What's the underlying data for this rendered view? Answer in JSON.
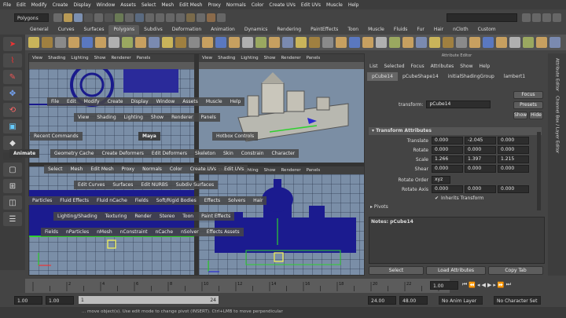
{
  "menubar": [
    "File",
    "Edit",
    "Modify",
    "Create",
    "Display",
    "Window",
    "Assets",
    "Select",
    "Mesh",
    "Edit Mesh",
    "Proxy",
    "Normals",
    "Color",
    "Create UVs",
    "Edit UVs",
    "Muscle",
    "Help"
  ],
  "status": {
    "mode": "Polygons"
  },
  "shelf_tabs": [
    "General",
    "Curves",
    "Surfaces",
    "Polygons",
    "Subdivs",
    "Deformation",
    "Animation",
    "Dynamics",
    "Rendering",
    "PaintEffects",
    "Toon",
    "Muscle",
    "Fluids",
    "Fur",
    "Hair",
    "nCloth",
    "Custom"
  ],
  "shelf_active": "Polygons",
  "viewport_menu": [
    "View",
    "Shading",
    "Lighting",
    "Show",
    "Renderer",
    "Panels"
  ],
  "hotbox": {
    "row1": [
      "File",
      "Edit",
      "Modify",
      "Create",
      "Display",
      "Window",
      "Assets",
      "Muscle",
      "Help"
    ],
    "row2": [
      "View",
      "Shading",
      "Lighting",
      "Show",
      "Renderer",
      "Panels"
    ],
    "recent": "Recent Commands",
    "maya": "Maya",
    "hotbox_controls": "Hotbox Controls",
    "row3": [
      "Geometry Cache",
      "Create Deformers",
      "Edit Deformers",
      "Skeleton",
      "Skin",
      "Constrain",
      "Character"
    ],
    "animate": "Animate",
    "row4": [
      "Select",
      "Mesh",
      "Edit Mesh",
      "Proxy",
      "Normals",
      "Color",
      "Create UVs",
      "Edit UVs"
    ],
    "row5": [
      "Edit Curves",
      "Surfaces",
      "Edit NURBS",
      "Subdiv Surfaces"
    ],
    "row6": [
      "Particles",
      "Fluid Effects",
      "Fluid nCache",
      "Fields",
      "Soft/Rigid Bodies",
      "Effects",
      "Solvers",
      "Hair"
    ],
    "row7": [
      "Lighting/Shading",
      "Texturing",
      "Render",
      "Stereo",
      "Toon",
      "Paint Effects"
    ],
    "row8": [
      "Fields",
      "nParticles",
      "nMesh",
      "nConstraint",
      "nCache",
      "nSolver",
      "Effects Assets"
    ]
  },
  "attr": {
    "title": "Attribute Editor",
    "menu": [
      "List",
      "Selected",
      "Focus",
      "Attributes",
      "Show",
      "Help"
    ],
    "tabs": [
      "pCube14",
      "pCubeShape14",
      "initialShadingGroup",
      "lambert1"
    ],
    "transform_label": "transform:",
    "transform_value": "pCube14",
    "focus": "Focus",
    "presets": "Presets",
    "show": "Show",
    "hide": "Hide",
    "section": "Transform Attributes",
    "translate": {
      "label": "Translate",
      "values": [
        "0.000",
        "-2.045",
        "0.000"
      ]
    },
    "rotate": {
      "label": "Rotate",
      "values": [
        "0.000",
        "0.000",
        "0.000"
      ]
    },
    "scale": {
      "label": "Scale",
      "values": [
        "1.266",
        "1.397",
        "1.215"
      ]
    },
    "shear": {
      "label": "Shear",
      "values": [
        "0.000",
        "0.000",
        "0.000"
      ]
    },
    "rotate_order_label": "Rotate Order",
    "rotate_order": "xyz",
    "rotate_axis": {
      "label": "Rotate Axis",
      "values": [
        "0.000",
        "0.000",
        "0.000"
      ]
    },
    "inherits": "Inherits Transform",
    "pivots": "Pivots",
    "notes": "Notes: pCube14",
    "btn_select": "Select",
    "btn_load": "Load Attributes",
    "btn_copy": "Copy Tab"
  },
  "side_tabs": [
    "Attribute Editor",
    "Channel Box / Layer Editor"
  ],
  "timeline": {
    "ticks": [
      "2",
      "4",
      "6",
      "8",
      "10",
      "12",
      "14",
      "16",
      "18",
      "20",
      "22",
      "24"
    ],
    "current_frame": "1.00"
  },
  "range": {
    "start": "1.00",
    "anim_start": "1.00",
    "slider_start": "1",
    "slider_end": "24",
    "anim_end": "24.00",
    "end": "48.00",
    "anim_layer": "No Anim Layer",
    "char_set": "No Character Set"
  },
  "helpline": "... move object(s). Use edit mode to change pivot (INSERT). Ctrl+LMB to move perpendicular",
  "colors": {
    "accent": "#5b8fd6",
    "viewport": "#7a8ea7",
    "model": "#1a1a8c"
  }
}
